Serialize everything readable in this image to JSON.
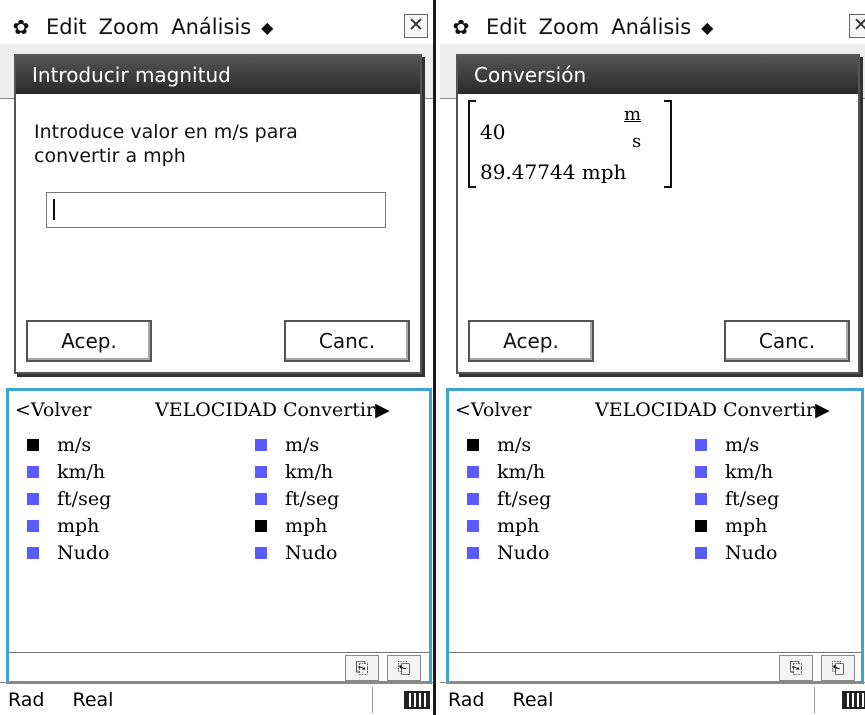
{
  "menubar": {
    "gear_icon": "gear-icon",
    "edit": "Edit",
    "zoom": "Zoom",
    "analysis": "Análisis",
    "diamond": "◆",
    "close": "✕"
  },
  "left_dialog": {
    "title": "Introducir magnitud",
    "prompt_line1": "Introduce valor en m/s para",
    "prompt_line2": "convertir a mph",
    "input_value": "",
    "ok": "Acep.",
    "cancel": "Canc."
  },
  "right_dialog": {
    "title": "Conversión",
    "value_in": "40",
    "unit_num": "m",
    "unit_den": "s",
    "value_out": "89.47744 mph",
    "ok": "Acep.",
    "cancel": "Canc."
  },
  "panel": {
    "back": "<Volver",
    "title": "VELOCIDAD",
    "convert": "Convertir▶",
    "units": [
      "m/s",
      "km/h",
      "ft/seg",
      "mph",
      "Nudo"
    ],
    "from_selected": "m/s",
    "to_selected": "mph"
  },
  "status": {
    "mode": "Rad",
    "format": "Real"
  },
  "colors": {
    "accent": "#3aa6d0",
    "unit_square": "#5a5aff",
    "selected_square": "#000000"
  }
}
